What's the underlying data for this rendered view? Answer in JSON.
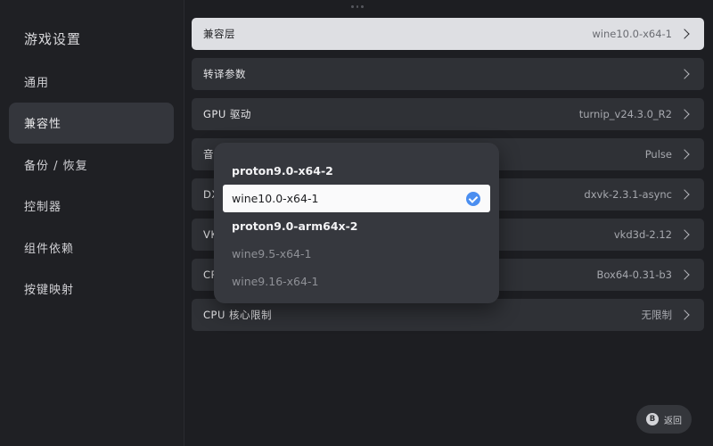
{
  "sidebar": {
    "title": "游戏设置",
    "items": [
      {
        "label": "通用"
      },
      {
        "label": "兼容性"
      },
      {
        "label": "备份 / 恢复"
      },
      {
        "label": "控制器"
      },
      {
        "label": "组件依赖"
      },
      {
        "label": "按键映射"
      }
    ],
    "active_index": 1
  },
  "settings": {
    "rows": [
      {
        "label": "兼容层",
        "value": "wine10.0-x64-1"
      },
      {
        "label": "转译参数",
        "value": ""
      },
      {
        "label": "GPU 驱动",
        "value": "turnip_v24.3.0_R2"
      },
      {
        "label": "音",
        "value": "Pulse"
      },
      {
        "label": "DX",
        "value": "dxvk-2.3.1-async"
      },
      {
        "label": "VK",
        "value": "vkd3d-2.12"
      },
      {
        "label": "CP",
        "value": "Box64-0.31-b3"
      },
      {
        "label": "CPU 核心限制",
        "value": "无限制"
      }
    ]
  },
  "dropdown": {
    "options": [
      {
        "label": "proton9.0-x64-2",
        "state": "enabled"
      },
      {
        "label": "wine10.0-x64-1",
        "state": "selected"
      },
      {
        "label": "proton9.0-arm64x-2",
        "state": "enabled"
      },
      {
        "label": "wine9.5-x64-1",
        "state": "disabled"
      },
      {
        "label": "wine9.16-x64-1",
        "state": "disabled"
      }
    ]
  },
  "back_button": {
    "icon_letter": "B",
    "label": "返回"
  },
  "colors": {
    "accent": "#4b8ef0",
    "background": "#1d1e22",
    "row": "#2f3136",
    "row_active": "#dedfe3"
  }
}
